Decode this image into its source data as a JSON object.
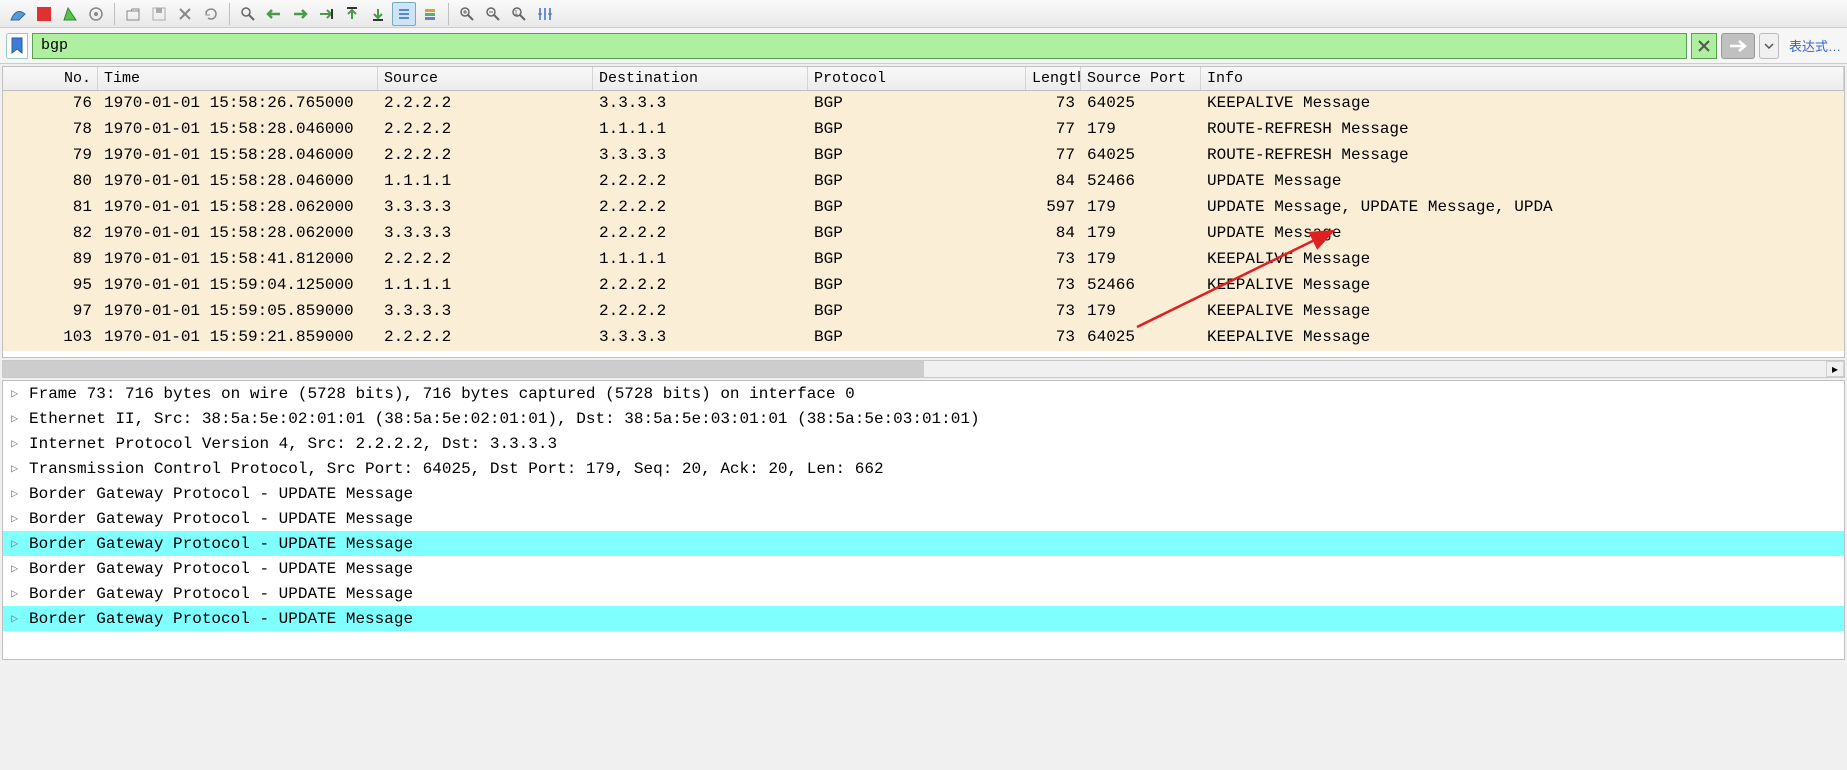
{
  "filter": {
    "value": "bgp",
    "expression_label": "表达式…"
  },
  "columns": {
    "no": "No.",
    "time": "Time",
    "src": "Source",
    "dst": "Destination",
    "proto": "Protocol",
    "len": "Length",
    "sport": "Source Port",
    "info": "Info"
  },
  "packets": [
    {
      "no": "76",
      "time": "1970-01-01 15:58:26.765000",
      "src": "2.2.2.2",
      "dst": "3.3.3.3",
      "proto": "BGP",
      "len": "73",
      "sport": "64025",
      "info": "KEEPALIVE Message"
    },
    {
      "no": "78",
      "time": "1970-01-01 15:58:28.046000",
      "src": "2.2.2.2",
      "dst": "1.1.1.1",
      "proto": "BGP",
      "len": "77",
      "sport": "179",
      "info": "ROUTE-REFRESH Message"
    },
    {
      "no": "79",
      "time": "1970-01-01 15:58:28.046000",
      "src": "2.2.2.2",
      "dst": "3.3.3.3",
      "proto": "BGP",
      "len": "77",
      "sport": "64025",
      "info": "ROUTE-REFRESH Message"
    },
    {
      "no": "80",
      "time": "1970-01-01 15:58:28.046000",
      "src": "1.1.1.1",
      "dst": "2.2.2.2",
      "proto": "BGP",
      "len": "84",
      "sport": "52466",
      "info": "UPDATE Message"
    },
    {
      "no": "81",
      "time": "1970-01-01 15:58:28.062000",
      "src": "3.3.3.3",
      "dst": "2.2.2.2",
      "proto": "BGP",
      "len": "597",
      "sport": "179",
      "info": "UPDATE Message, UPDATE Message, UPDA"
    },
    {
      "no": "82",
      "time": "1970-01-01 15:58:28.062000",
      "src": "3.3.3.3",
      "dst": "2.2.2.2",
      "proto": "BGP",
      "len": "84",
      "sport": "179",
      "info": "UPDATE Message"
    },
    {
      "no": "89",
      "time": "1970-01-01 15:58:41.812000",
      "src": "2.2.2.2",
      "dst": "1.1.1.1",
      "proto": "BGP",
      "len": "73",
      "sport": "179",
      "info": "KEEPALIVE Message"
    },
    {
      "no": "95",
      "time": "1970-01-01 15:59:04.125000",
      "src": "1.1.1.1",
      "dst": "2.2.2.2",
      "proto": "BGP",
      "len": "73",
      "sport": "52466",
      "info": "KEEPALIVE Message"
    },
    {
      "no": "97",
      "time": "1970-01-01 15:59:05.859000",
      "src": "3.3.3.3",
      "dst": "2.2.2.2",
      "proto": "BGP",
      "len": "73",
      "sport": "179",
      "info": "KEEPALIVE Message"
    },
    {
      "no": "103",
      "time": "1970-01-01 15:59:21.859000",
      "src": "2.2.2.2",
      "dst": "3.3.3.3",
      "proto": "BGP",
      "len": "73",
      "sport": "64025",
      "info": "KEEPALIVE Message"
    }
  ],
  "details": [
    {
      "text": "Frame 73: 716 bytes on wire (5728 bits), 716 bytes captured (5728 bits) on interface 0",
      "hl": false
    },
    {
      "text": "Ethernet II, Src: 38:5a:5e:02:01:01 (38:5a:5e:02:01:01), Dst: 38:5a:5e:03:01:01 (38:5a:5e:03:01:01)",
      "hl": false
    },
    {
      "text": "Internet Protocol Version 4, Src: 2.2.2.2, Dst: 3.3.3.3",
      "hl": false
    },
    {
      "text": "Transmission Control Protocol, Src Port: 64025, Dst Port: 179, Seq: 20, Ack: 20, Len: 662",
      "hl": false
    },
    {
      "text": "Border Gateway Protocol - UPDATE Message",
      "hl": false
    },
    {
      "text": "Border Gateway Protocol - UPDATE Message",
      "hl": false
    },
    {
      "text": "Border Gateway Protocol - UPDATE Message",
      "hl": true
    },
    {
      "text": "Border Gateway Protocol - UPDATE Message",
      "hl": false
    },
    {
      "text": "Border Gateway Protocol - UPDATE Message",
      "hl": false
    },
    {
      "text": "Border Gateway Protocol - UPDATE Message",
      "hl": true
    }
  ]
}
